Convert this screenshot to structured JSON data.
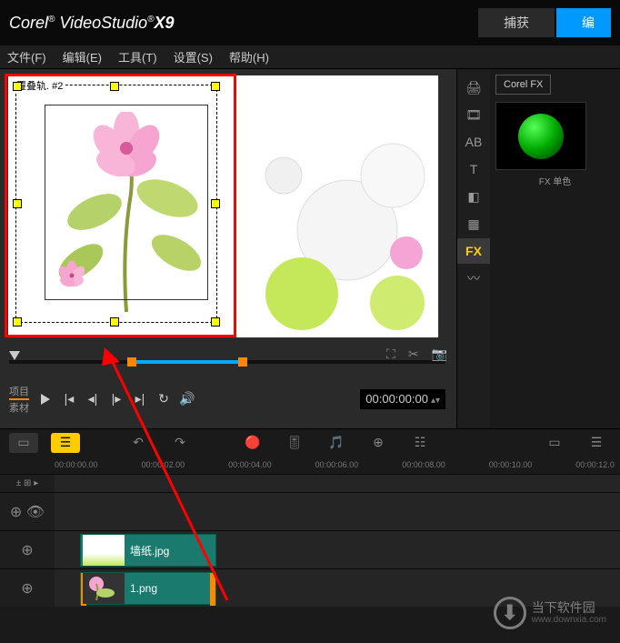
{
  "app": {
    "brand": "Corel",
    "name": "VideoStudio",
    "version": "X9"
  },
  "tabs": {
    "capture": "捕获",
    "edit": "编"
  },
  "menu": {
    "file": "文件(F)",
    "edit": "编辑(E)",
    "tools": "工具(T)",
    "settings": "设置(S)",
    "help": "帮助(H)"
  },
  "preview": {
    "overlay_label": "覆叠轨. #2"
  },
  "controls": {
    "project": "项目",
    "clip": "素材",
    "timecode": "00:00:00:00"
  },
  "fx": {
    "tab": "Corel FX",
    "thumb_label": "FX 单色"
  },
  "tool_strip": {
    "fx": "FX",
    "ab": "AB",
    "t": "T"
  },
  "ruler": [
    "00:00:00.00",
    "00:00:02.00",
    "00:00:04.00",
    "00:00:06.00",
    "00:00:08.00",
    "00:00:10.00",
    "00:00:12.0"
  ],
  "clips": {
    "wallpaper": "墙纸.jpg",
    "overlay": "1.png"
  },
  "watermark": {
    "name": "当下软件园",
    "url": "www.downxia.com"
  }
}
